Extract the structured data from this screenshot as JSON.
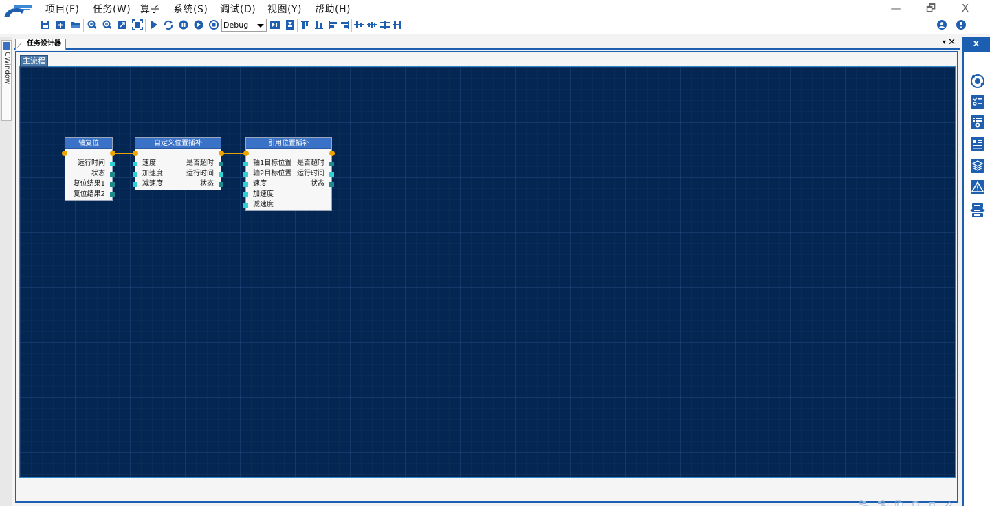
{
  "app": {
    "logo_icon": "gcan-logo-icon"
  },
  "menu": {
    "items": [
      "项目(F)",
      "任务(W)",
      "算子",
      "系统(S)",
      "调试(D)",
      "视图(Y)",
      "帮助(H)"
    ]
  },
  "window": {
    "minimize": "—",
    "restore": "🗗",
    "close": "X"
  },
  "toolbar": {
    "config_select": "Debug",
    "icons": [
      "save-icon",
      "new-icon",
      "open-icon",
      "zoom-in-icon",
      "zoom-out-icon",
      "fit-icon",
      "fullscreen-icon",
      "run-icon",
      "loop-icon",
      "pause-icon",
      "step-icon",
      "stop-icon",
      "align-start-icon",
      "align-end-icon",
      "align-top-icon",
      "align-bottom-icon",
      "align-left-icon",
      "align-right-icon",
      "center-h-icon",
      "center-v-icon",
      "distribute-h-icon",
      "distribute-v-icon",
      "user-icon",
      "info-icon"
    ]
  },
  "left_strip": {
    "tab_label": "GWindow"
  },
  "designer": {
    "tab_label": "任务设计器",
    "dropdown": "▾",
    "close": "✕",
    "flow_tab_label": "主流程"
  },
  "nodes": [
    {
      "title": "轴复位",
      "inputs": [],
      "outputs": [
        "运行时间",
        "状态",
        "复位结果1",
        "复位结果2"
      ]
    },
    {
      "title": "自定义位置插补",
      "inputs": [
        "速度",
        "加速度",
        "减速度"
      ],
      "outputs": [
        "是否超时",
        "运行时间",
        "状态"
      ]
    },
    {
      "title": "引用位置插补",
      "inputs": [
        "轴1目标位置",
        "轴2目标位置",
        "速度",
        "加速度",
        "减速度"
      ],
      "outputs": [
        "是否超时",
        "运行时间",
        "状态"
      ]
    }
  ],
  "bottom_tools": [
    "group-icon",
    "ungroup-icon",
    "copy-icon",
    "paste-icon",
    "delete-icon",
    "clear-icon"
  ],
  "right_panel": {
    "close": "x",
    "icons": [
      "orbit-icon",
      "checklist-icon",
      "settings-list-icon",
      "card-list-icon",
      "layers-icon",
      "warning-icon",
      "stack-icon"
    ]
  },
  "colors": {
    "canvas_bg": "#042652",
    "accent": "#1c5fb0",
    "node_header": "#3a72c8",
    "port": "#2fd0d8",
    "flow_link": "#e8a000"
  }
}
